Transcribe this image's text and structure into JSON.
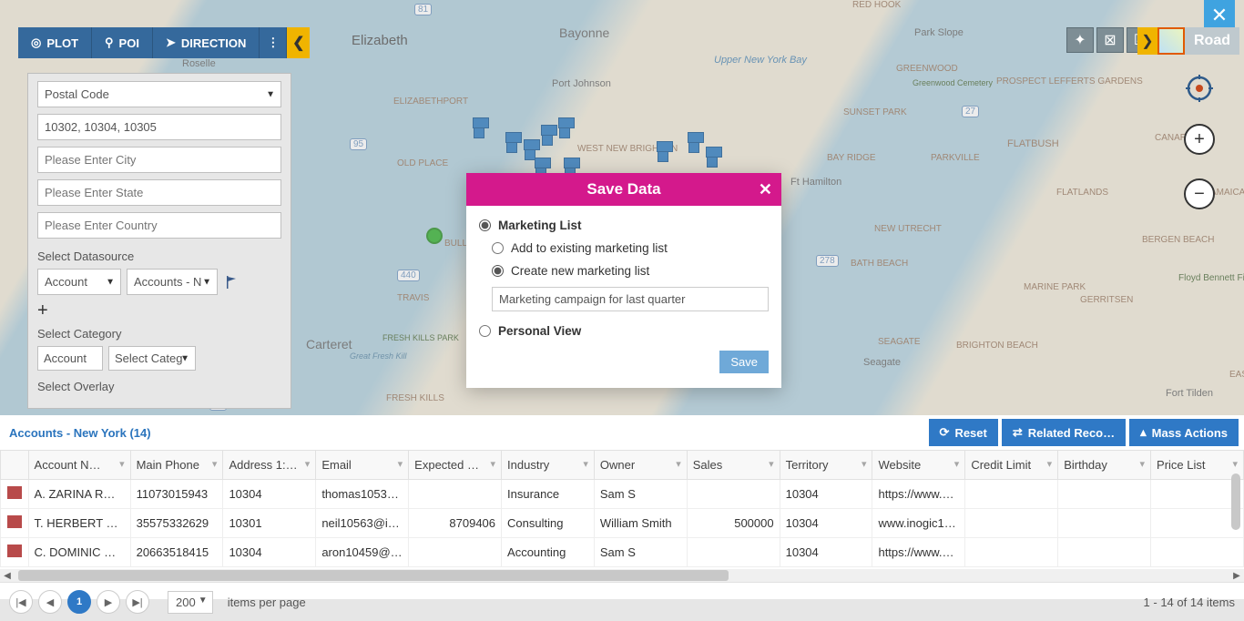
{
  "toolbar": {
    "plot": "PLOT",
    "poi": "POI",
    "direction": "DIRECTION"
  },
  "road_label": "Road",
  "panel": {
    "postal_code_label": "Postal Code",
    "postal_values": "10302, 10304, 10305",
    "city_ph": "Please Enter City",
    "state_ph": "Please Enter State",
    "country_ph": "Please Enter Country",
    "datasource_label": "Select Datasource",
    "ds1": "Account",
    "ds2": "Accounts - N",
    "category_label": "Select Category",
    "cat1": "Account",
    "cat2": "Select Categ",
    "overlay_label": "Select Overlay"
  },
  "modal": {
    "title": "Save Data",
    "opt_marketing": "Marketing List",
    "opt_add_existing": "Add to existing marketing list",
    "opt_create_new": "Create new marketing list",
    "list_name": "Marketing campaign for last quarter",
    "opt_personal": "Personal View",
    "save": "Save"
  },
  "map_locations": {
    "elizabeth": "Elizabeth",
    "roselle": "Roselle",
    "bayonne": "Bayonne",
    "upperbay": "Upper New York Bay",
    "elizabethport": "ELIZABETHPORT",
    "portjohnson": "Port Johnson",
    "westnewbrighton": "WEST NEW\nBRIGHTON",
    "oldplace": "OLD PLACE",
    "bulls": "BULLS",
    "carteret": "Carteret",
    "travis": "TRAVIS",
    "freshkillspark": "FRESH KILLS PARK",
    "greatfreshkill": "Great\nFresh\nKill",
    "freshkills": "FRESH KILLS",
    "fthamilton": "Ft Hamilton",
    "bayridge": "BAY RIDGE",
    "newutrecht": "NEW UTRECHT",
    "bathbeach": "BATH BEACH",
    "seagate": "SEAGATE",
    "seagate2": "Seagate",
    "redhook": "RED HOOK",
    "parkslope": "Park Slope",
    "greenwood": "GREENWOOD",
    "greenwoodcem": "Greenwood\nCemetery",
    "sunsetpark": "SUNSET PARK",
    "parkville": "PARKVILLE",
    "prospectgardens": "PROSPECT\nLEFFERTS\nGARDENS",
    "flatbush": "FLATBUSH",
    "flatlands": "FLATLANDS",
    "jamaicabay": "JAMAICA BAY",
    "canars": "CANARS",
    "bergenbeach": "BERGEN BEACH",
    "marinepark": "MARINE PARK",
    "gerritsen": "GERRITSEN",
    "floydbennett": "Floyd\nBennett\nField",
    "brightonbeach": "BRIGHTON BEACH",
    "forttilden": "Fort Tilden",
    "eas": "EAS"
  },
  "grid": {
    "title": "Accounts - New York (14)",
    "reset": "Reset",
    "related": "Related Reco…",
    "mass": "Mass Actions",
    "columns": [
      "Account N…",
      "Main Phone",
      "Address 1:…",
      "Email",
      "Expected …",
      "Industry",
      "Owner",
      "Sales",
      "Territory",
      "Website",
      "Credit Limit",
      "Birthday",
      "Price List"
    ],
    "rows": [
      {
        "acct": "A. ZARINA R…",
        "phone": "11073015943",
        "addr": "10304",
        "email": "thomas1053…",
        "expected": "",
        "industry": "Insurance",
        "owner": "Sam S",
        "sales": "",
        "territory": "10304",
        "website": "https://www.…",
        "credit": "",
        "birthday": "",
        "price": ""
      },
      {
        "acct": "T. HERBERT …",
        "phone": "35575332629",
        "addr": "10301",
        "email": "neil10563@i…",
        "expected": "8709406",
        "industry": "Consulting",
        "owner": "William Smith",
        "sales": "500000",
        "territory": "10304",
        "website": "www.inogic1…",
        "credit": "",
        "birthday": "",
        "price": ""
      },
      {
        "acct": "C. DOMINIC …",
        "phone": "20663518415",
        "addr": "10304",
        "email": "aron10459@…",
        "expected": "",
        "industry": "Accounting",
        "owner": "Sam S",
        "sales": "",
        "territory": "10304",
        "website": "https://www.…",
        "credit": "",
        "birthday": "",
        "price": ""
      }
    ]
  },
  "pager": {
    "page_size": "200",
    "items_label": "items per page",
    "range": "1 - 14 of 14 items",
    "current": "1"
  }
}
